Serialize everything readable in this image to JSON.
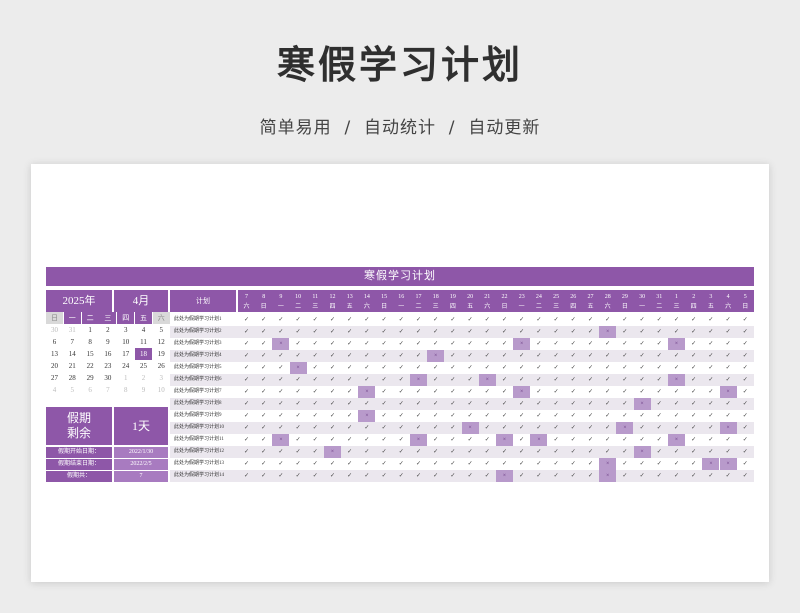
{
  "page": {
    "title": "寒假学习计划",
    "subtitle": "简单易用  /  自动统计  /  自动更新"
  },
  "sheet": {
    "banner": "寒假学习计划",
    "calendar": {
      "year": "2025年",
      "month": "4月",
      "weekdays": [
        "日",
        "一",
        "二",
        "三",
        "四",
        "五",
        "六"
      ],
      "weeks": [
        [
          "30",
          "31",
          "1",
          "2",
          "3",
          "4",
          "5"
        ],
        [
          "6",
          "7",
          "8",
          "9",
          "10",
          "11",
          "12"
        ],
        [
          "13",
          "14",
          "15",
          "16",
          "17",
          "18",
          "19"
        ],
        [
          "20",
          "21",
          "22",
          "23",
          "24",
          "25",
          "26"
        ],
        [
          "27",
          "28",
          "29",
          "30",
          "1",
          "2",
          "3"
        ],
        [
          "4",
          "5",
          "6",
          "7",
          "8",
          "9",
          "10"
        ]
      ],
      "dim_flags": [
        [
          1,
          1,
          0,
          0,
          0,
          0,
          0
        ],
        [
          0,
          0,
          0,
          0,
          0,
          0,
          0
        ],
        [
          0,
          0,
          0,
          0,
          0,
          0,
          0
        ],
        [
          0,
          0,
          0,
          0,
          0,
          0,
          0
        ],
        [
          0,
          0,
          0,
          0,
          1,
          1,
          1
        ],
        [
          1,
          1,
          1,
          1,
          1,
          1,
          1
        ]
      ],
      "today": {
        "week": 2,
        "day": 5
      }
    },
    "info": {
      "remain_label": "假期\n剩余",
      "remain_value": "1天",
      "start_label": "假期开始日期：",
      "start_value": "2022/1/30",
      "end_label": "假期结束日期：",
      "end_value": "2022/2/5",
      "total_label": "假期共：",
      "total_value": "7"
    },
    "plan_header": "计划",
    "dates": [
      "7",
      "8",
      "9",
      "10",
      "11",
      "12",
      "13",
      "14",
      "15",
      "16",
      "17",
      "18",
      "19",
      "20",
      "21",
      "22",
      "23",
      "24",
      "25",
      "26",
      "27",
      "28",
      "29",
      "30",
      "31",
      "1",
      "2",
      "3",
      "4",
      "5"
    ],
    "weekdays": [
      "六",
      "日",
      "一",
      "二",
      "三",
      "四",
      "五",
      "六",
      "日",
      "一",
      "二",
      "三",
      "四",
      "五",
      "六",
      "日",
      "一",
      "二",
      "三",
      "四",
      "五",
      "六",
      "日",
      "一",
      "二",
      "三",
      "四",
      "五",
      "六",
      "日"
    ],
    "check_mark": "✓",
    "cross_mark": "×",
    "plans": [
      {
        "name": "此处为假期学习计划1",
        "x": []
      },
      {
        "name": "此处为假期学习计划2",
        "x": [
          21
        ]
      },
      {
        "name": "此处为假期学习计划3",
        "x": [
          2,
          16,
          25
        ]
      },
      {
        "name": "此处为假期学习计划4",
        "x": [
          11
        ]
      },
      {
        "name": "此处为假期学习计划5",
        "x": [
          3
        ]
      },
      {
        "name": "此处为假期学习计划6",
        "x": [
          10,
          14,
          25
        ]
      },
      {
        "name": "此处为假期学习计划7",
        "x": [
          7,
          16,
          28
        ]
      },
      {
        "name": "此处为假期学习计划8",
        "x": [
          23
        ]
      },
      {
        "name": "此处为假期学习计划9",
        "x": [
          7
        ]
      },
      {
        "name": "此处为假期学习计划10",
        "x": [
          13,
          22,
          28
        ]
      },
      {
        "name": "此处为假期学习计划11",
        "x": [
          2,
          10,
          15,
          17,
          25
        ]
      },
      {
        "name": "此处为假期学习计划12",
        "x": [
          5,
          23
        ]
      },
      {
        "name": "此处为假期学习计划13",
        "x": [
          21,
          27,
          28
        ]
      },
      {
        "name": "此处为假期学习计划14",
        "x": [
          15,
          21
        ]
      }
    ]
  }
}
